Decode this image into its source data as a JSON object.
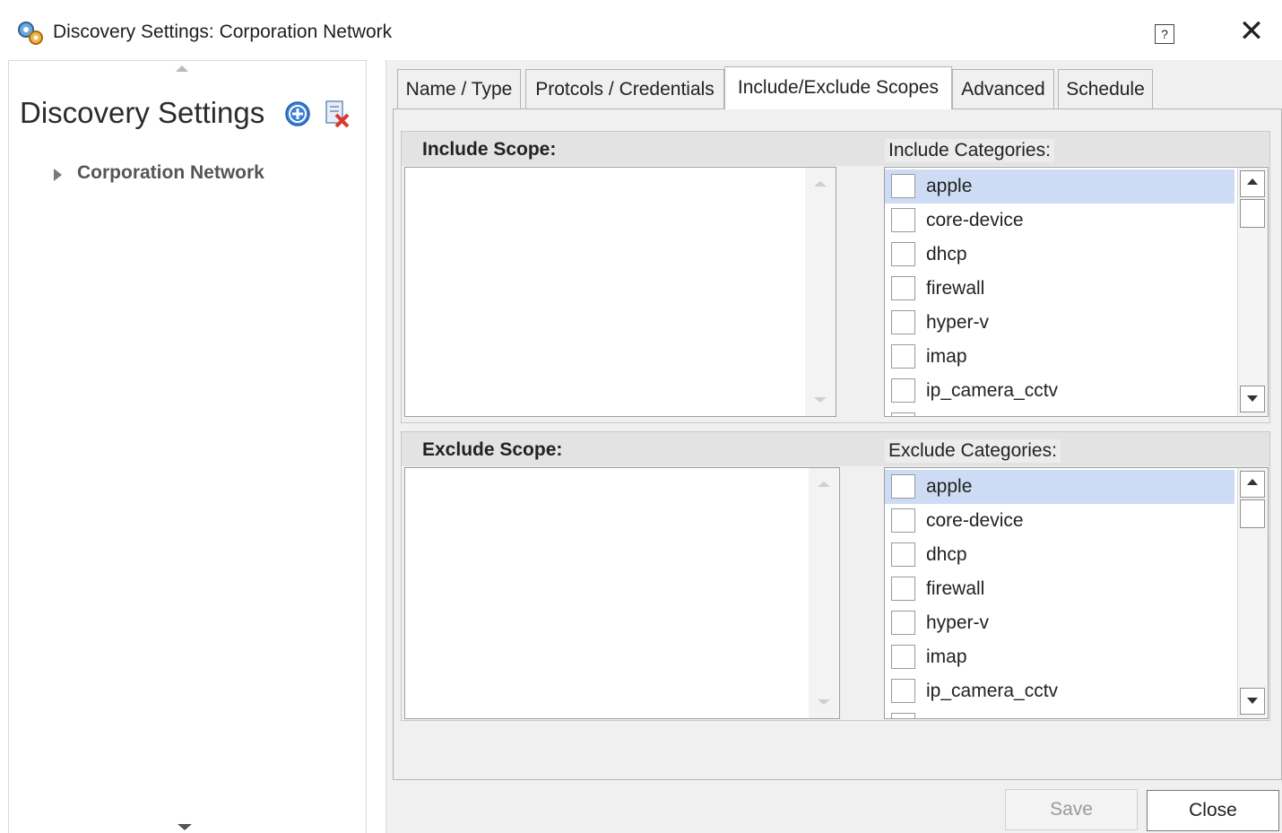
{
  "window": {
    "title": "Discovery Settings: Corporation Network",
    "help_glyph": "?",
    "close_glyph": "✕"
  },
  "sidebar": {
    "title": "Discovery Settings",
    "tree": [
      {
        "label": "Corporation Network"
      }
    ]
  },
  "tabs": [
    {
      "label": "Name / Type"
    },
    {
      "label": "Protcols / Credentials"
    },
    {
      "label": "Include/Exclude Scopes",
      "active": true
    },
    {
      "label": "Advanced"
    },
    {
      "label": "Schedule"
    }
  ],
  "include": {
    "scope_label": "Include Scope:",
    "categories_label": "Include Categories:",
    "scope_value": "",
    "categories": [
      {
        "label": "apple",
        "checked": false,
        "selected": true
      },
      {
        "label": "core-device",
        "checked": false
      },
      {
        "label": "dhcp",
        "checked": false
      },
      {
        "label": "firewall",
        "checked": false
      },
      {
        "label": "hyper-v",
        "checked": false
      },
      {
        "label": "imap",
        "checked": false
      },
      {
        "label": "ip_camera_cctv",
        "checked": false
      },
      {
        "label": "",
        "checked": false
      }
    ]
  },
  "exclude": {
    "scope_label": "Exclude Scope:",
    "categories_label": "Exclude Categories:",
    "scope_value": "",
    "categories": [
      {
        "label": "apple",
        "checked": false,
        "selected": true
      },
      {
        "label": "core-device",
        "checked": false
      },
      {
        "label": "dhcp",
        "checked": false
      },
      {
        "label": "firewall",
        "checked": false
      },
      {
        "label": "hyper-v",
        "checked": false
      },
      {
        "label": "imap",
        "checked": false
      },
      {
        "label": "ip_camera_cctv",
        "checked": false
      },
      {
        "label": "",
        "checked": false
      }
    ]
  },
  "buttons": {
    "save": "Save",
    "close": "Close",
    "save_enabled": false
  },
  "colors": {
    "selection": "#cddcf4",
    "add_icon": "#3a7fd5",
    "delete_icon": "#d83b2c",
    "app_icon": "#4a86c8"
  }
}
